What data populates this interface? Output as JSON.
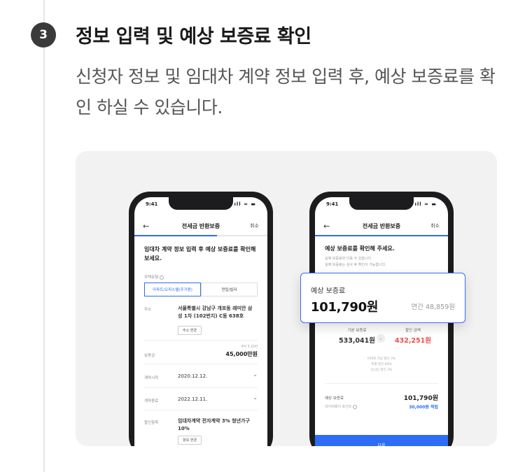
{
  "step": {
    "number": "3",
    "title": "정보 입력 및 예상 보증료 확인",
    "description": "신청자 정보 및 임대차 계약 정보 입력 후, 예상 보증료를 확인 하실 수 있습니다."
  },
  "colors": {
    "accent": "#2e6cf6",
    "discount": "#e85050",
    "badge": "#3a3a3a"
  },
  "phone_left": {
    "time": "9:41",
    "status_icons": "ıll ≈ ▬",
    "back_icon": "arrow-left-icon",
    "nav_title": "전세금 반환보증",
    "nav_cancel": "취소",
    "progress": 0.62,
    "heading": "임대차 계약 정보 입력 후 예상 보증료를 확인해 보세요.",
    "house_type_label": "주택유형",
    "house_type_options": [
      "아파트/오피스텔(주거용)",
      "연립/빌라"
    ],
    "house_type_selected": "아파트/오피스텔(주거용)",
    "address_label": "주소",
    "address_value": "서울특별시 강남구 개포동 래미안 삼성 1차 (102번지) C동 638호",
    "address_button": "주소 변경",
    "deposit_label": "보증금",
    "deposit_hint": "4억 5,000",
    "deposit_value": "45,000만원",
    "start_label": "계약시작",
    "start_value": "2020.12.12.",
    "end_label": "계약종료",
    "end_value": "2022.12.11.",
    "discount_label": "할인항목",
    "discount_value": "임대차계약 전자계약 3% 청년가구 10%",
    "discount_button": "항목 변경"
  },
  "phone_right": {
    "time": "9:41",
    "status_icons": "ıll ≈ ▬",
    "back_icon": "arrow-left-icon",
    "nav_title": "전세금 반환보증",
    "nav_cancel": "취소",
    "progress": 1.0,
    "heading": "예상 보증료를 확인해 주세요.",
    "sub1": "실제 보증료와 다를 수 있습니다",
    "sub2": "실제 보증료는 심사 후 확인이 가능합니다.",
    "base_label": "기본 보증료",
    "base_value": "533,041원",
    "minus": "-",
    "discount_label": "할인 금액",
    "discount_value": "432,251원",
    "discount_lines": [
      "비대면 가입 할인 3%",
      "특별 할인 80%",
      "임시납 할인 3%"
    ],
    "expected_label": "예상 보증료",
    "expected_value": "101,790원",
    "points_label": "네이버페이 포인트",
    "points_value": "30,000원 적립",
    "cta": "다음"
  },
  "popup": {
    "label": "예상 보증료",
    "amount": "101,790원",
    "annual": "연간 48,859원"
  }
}
